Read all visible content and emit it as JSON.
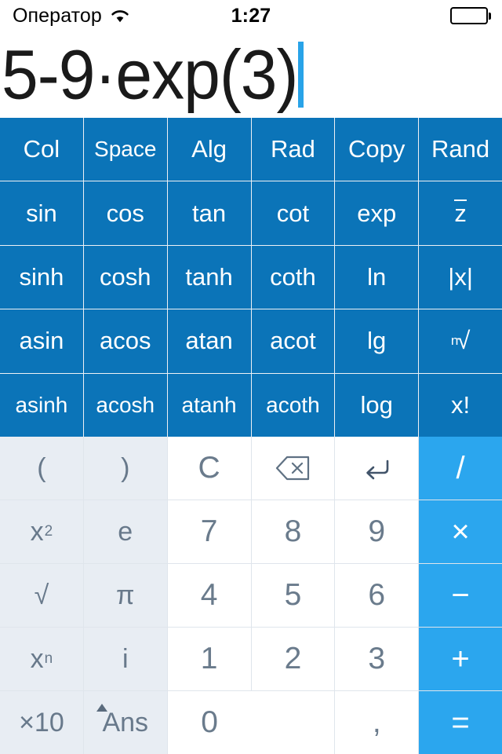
{
  "statusbar": {
    "carrier": "Оператор",
    "wifi_icon": "wifi-icon",
    "time": "1:27",
    "battery_icon": "battery-full-icon"
  },
  "display": {
    "expression": "5-9·exp(3)",
    "cursor_color": "#29a3e8"
  },
  "colors": {
    "function_blue": "#0b74b8",
    "operator_blue": "#2ba6ee",
    "light_key": "#e8edf3",
    "number_key": "#ffffff",
    "number_text": "#6a7b8c",
    "light_text": "#68798b"
  },
  "function_keys": {
    "rows": [
      [
        {
          "label": "Col",
          "name": "key-col"
        },
        {
          "label": "Space",
          "name": "key-space"
        },
        {
          "label": "Alg",
          "name": "key-alg"
        },
        {
          "label": "Rad",
          "name": "key-rad"
        },
        {
          "label": "Copy",
          "name": "key-copy"
        },
        {
          "label": "Rand",
          "name": "key-rand"
        }
      ],
      [
        {
          "label": "sin",
          "name": "key-sin"
        },
        {
          "label": "cos",
          "name": "key-cos"
        },
        {
          "label": "tan",
          "name": "key-tan"
        },
        {
          "label": "cot",
          "name": "key-cot"
        },
        {
          "label": "exp",
          "name": "key-exp"
        },
        {
          "label": "z",
          "name": "key-conjugate",
          "overline": true
        }
      ],
      [
        {
          "label": "sinh",
          "name": "key-sinh"
        },
        {
          "label": "cosh",
          "name": "key-cosh"
        },
        {
          "label": "tanh",
          "name": "key-tanh"
        },
        {
          "label": "coth",
          "name": "key-coth"
        },
        {
          "label": "ln",
          "name": "key-ln"
        },
        {
          "label": "|x|",
          "name": "key-abs"
        }
      ],
      [
        {
          "label": "asin",
          "name": "key-asin"
        },
        {
          "label": "acos",
          "name": "key-acos"
        },
        {
          "label": "atan",
          "name": "key-atan"
        },
        {
          "label": "acot",
          "name": "key-acot"
        },
        {
          "label": "lg",
          "name": "key-lg"
        },
        {
          "label": "√",
          "name": "key-nth-root",
          "prefix": "n"
        }
      ],
      [
        {
          "label": "asinh",
          "name": "key-asinh"
        },
        {
          "label": "acosh",
          "name": "key-acosh"
        },
        {
          "label": "atanh",
          "name": "key-atanh"
        },
        {
          "label": "acoth",
          "name": "key-acoth"
        },
        {
          "label": "log",
          "name": "key-log"
        },
        {
          "label": "x!",
          "name": "key-factorial"
        }
      ]
    ]
  },
  "keypad": {
    "row1": [
      {
        "label": "(",
        "name": "key-open-paren"
      },
      {
        "label": ")",
        "name": "key-close-paren"
      },
      {
        "label": "C",
        "name": "key-clear"
      },
      {
        "label": "",
        "name": "key-backspace",
        "icon": "backspace-icon"
      },
      {
        "label": "",
        "name": "key-enter",
        "icon": "return-arrow-icon"
      },
      {
        "label": "/",
        "name": "key-divide"
      }
    ],
    "row2": [
      {
        "label": "x",
        "sup": "2",
        "name": "key-square"
      },
      {
        "label": "e",
        "name": "key-euler"
      },
      {
        "label": "7",
        "name": "key-7"
      },
      {
        "label": "8",
        "name": "key-8"
      },
      {
        "label": "9",
        "name": "key-9"
      },
      {
        "label": "×",
        "name": "key-multiply"
      }
    ],
    "row3": [
      {
        "label": "√",
        "name": "key-sqrt"
      },
      {
        "label": "π",
        "name": "key-pi"
      },
      {
        "label": "4",
        "name": "key-4"
      },
      {
        "label": "5",
        "name": "key-5"
      },
      {
        "label": "6",
        "name": "key-6"
      },
      {
        "label": "−",
        "name": "key-subtract"
      }
    ],
    "row4": [
      {
        "label": "x",
        "sup": "n",
        "name": "key-power"
      },
      {
        "label": "i",
        "name": "key-imaginary"
      },
      {
        "label": "1",
        "name": "key-1"
      },
      {
        "label": "2",
        "name": "key-2"
      },
      {
        "label": "3",
        "name": "key-3"
      },
      {
        "label": "+",
        "name": "key-add"
      }
    ],
    "row5": [
      {
        "label": "×10",
        "name": "key-times-ten"
      },
      {
        "label": "Ans",
        "name": "key-ans",
        "badge": "triangle-up-icon"
      },
      {
        "label": "0",
        "name": "key-0",
        "span": 2
      },
      {
        "label": ",",
        "name": "key-comma"
      },
      {
        "label": "=",
        "name": "key-equals"
      }
    ]
  }
}
